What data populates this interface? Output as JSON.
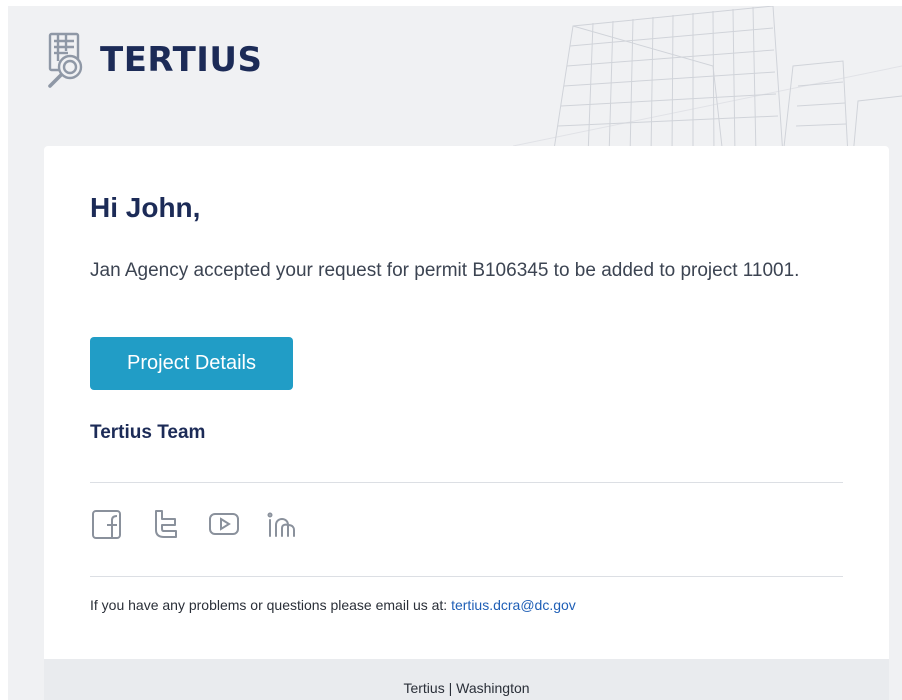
{
  "brand": {
    "name": "TERTIUS",
    "logo_icon": "building-magnifier-icon",
    "color": "#1c2b57"
  },
  "email": {
    "greeting": "Hi John,",
    "message": "Jan Agency accepted your request for permit B106345 to be added to project 11001.",
    "cta_label": "Project Details",
    "cta_color": "#219dc6",
    "signoff": "Tertius Team"
  },
  "social": [
    {
      "icon": "facebook-icon"
    },
    {
      "icon": "twitter-icon"
    },
    {
      "icon": "youtube-icon"
    },
    {
      "icon": "linkedin-icon"
    }
  ],
  "contact": {
    "text": "If you have any problems or questions please email us at:",
    "email": "tertius.dcra@dc.gov",
    "link_color": "#1f5fb6"
  },
  "footer": {
    "text": "Tertius | Washington"
  }
}
